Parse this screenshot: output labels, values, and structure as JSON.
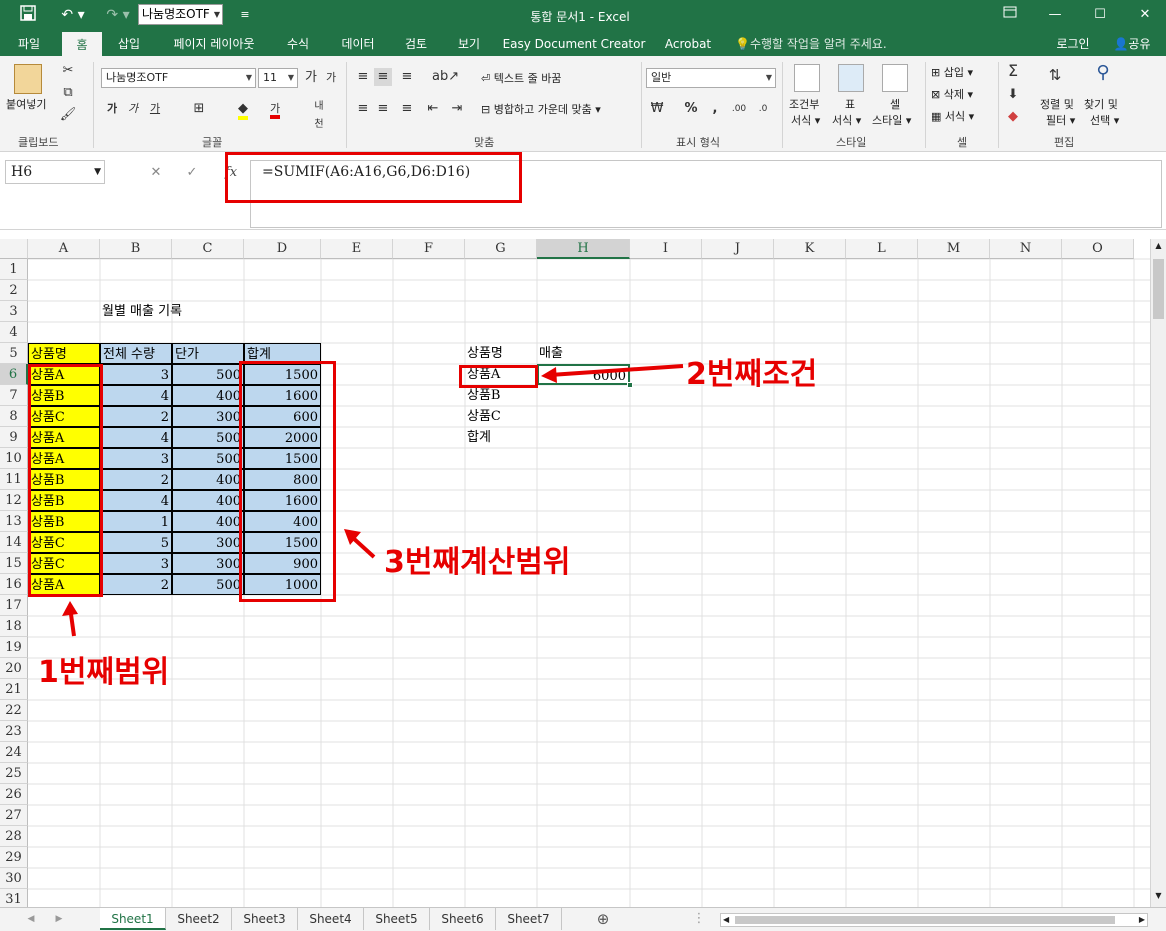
{
  "titlebar": {
    "font_name": "나눔명조OTF",
    "title": "통합 문서1 - Excel"
  },
  "tabs": [
    "파일",
    "홈",
    "삽입",
    "페이지 레이아웃",
    "수식",
    "데이터",
    "검토",
    "보기",
    "Easy Document Creator",
    "Acrobat"
  ],
  "tell_me": "수행할 작업을 알려 주세요.",
  "login": "로그인",
  "share": "공유",
  "ribbon": {
    "paste": "붙여넣기",
    "clipboard": "클립보드",
    "font_name": "나눔명조OTF",
    "font_size": "11",
    "font_group": "글꼴",
    "wrap_text": "텍스트 줄 바꿈",
    "merge_center": "병합하고 가운데 맞춤",
    "align_group": "맞춤",
    "number_format": "일반",
    "number_group": "표시 형식",
    "cond_format_1": "조건부",
    "cond_format_2": "서식",
    "table_1": "표",
    "table_2": "서식",
    "cell_style_1": "셀",
    "cell_style_2": "스타일",
    "style_group": "스타일",
    "insert": "삽입",
    "delete": "삭제",
    "format": "서식",
    "cells_group": "셀",
    "sort_1": "정렬 및",
    "sort_2": "필터",
    "find_1": "찾기 및",
    "find_2": "선택",
    "edit_group": "편집"
  },
  "formula_bar": {
    "name_box": "H6",
    "formula": "=SUMIF(A6:A16,G6,D6:D16)"
  },
  "columns": [
    "A",
    "B",
    "C",
    "D",
    "E",
    "F",
    "G",
    "H",
    "I",
    "J",
    "K",
    "L",
    "M",
    "N",
    "O"
  ],
  "rows": [
    "1",
    "2",
    "3",
    "4",
    "5",
    "6",
    "7",
    "8",
    "9",
    "10",
    "11",
    "12",
    "13",
    "14",
    "15",
    "16",
    "17",
    "18",
    "19",
    "20",
    "21",
    "22",
    "23",
    "24",
    "25",
    "26",
    "27",
    "28",
    "29",
    "30",
    "31"
  ],
  "sheet": {
    "title": "월별 매출 기록",
    "headers": [
      "상품명",
      "전체 수량",
      "단가",
      "합계"
    ],
    "data": [
      [
        "상품A",
        "3",
        "500",
        "1500"
      ],
      [
        "상품B",
        "4",
        "400",
        "1600"
      ],
      [
        "상품C",
        "2",
        "300",
        "600"
      ],
      [
        "상품A",
        "4",
        "500",
        "2000"
      ],
      [
        "상품A",
        "3",
        "500",
        "1500"
      ],
      [
        "상품B",
        "2",
        "400",
        "800"
      ],
      [
        "상품B",
        "4",
        "400",
        "1600"
      ],
      [
        "상품B",
        "1",
        "400",
        "400"
      ],
      [
        "상품C",
        "5",
        "300",
        "1500"
      ],
      [
        "상품C",
        "3",
        "300",
        "900"
      ],
      [
        "상품A",
        "2",
        "500",
        "1000"
      ]
    ],
    "summary_header": [
      "상품명",
      "매출"
    ],
    "summary_rows": [
      "상품A",
      "상품B",
      "상품C",
      "합계"
    ],
    "summary_value": "6000"
  },
  "annotations": {
    "first": "1번째범위",
    "second": "2번째조건",
    "third": "3번째계산범위"
  },
  "sheet_tabs": [
    "Sheet1",
    "Sheet2",
    "Sheet3",
    "Sheet4",
    "Sheet5",
    "Sheet6",
    "Sheet7"
  ],
  "colors": {
    "excel_green": "#217346",
    "highlight_yellow": "#ffff00",
    "highlight_blue": "#bdd7ee",
    "annotation_red": "#e60000"
  }
}
